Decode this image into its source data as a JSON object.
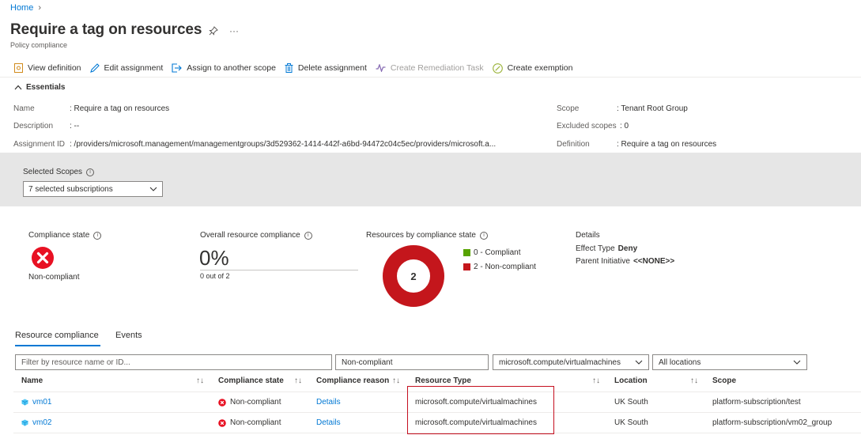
{
  "breadcrumb": {
    "home": "Home"
  },
  "page": {
    "title": "Require a tag on resources",
    "subtitle": "Policy compliance",
    "more": "···"
  },
  "toolbar": {
    "view_definition": "View definition",
    "edit_assignment": "Edit assignment",
    "assign_scope": "Assign to another scope",
    "delete_assignment": "Delete assignment",
    "create_remediation": "Create Remediation Task",
    "create_exemption": "Create exemption"
  },
  "essentials": {
    "header": "Essentials",
    "name_label": "Name",
    "name_value": ": Require a tag on resources",
    "description_label": "Description",
    "description_value": ": --",
    "assignment_id_label": "Assignment ID",
    "assignment_id_value": ": /providers/microsoft.management/managementgroups/3d529362-1414-442f-a6bd-94472c04c5ec/providers/microsoft.a...",
    "scope_label": "Scope",
    "scope_value": ": Tenant Root Group",
    "excluded_label": "Excluded scopes",
    "excluded_value": ": 0",
    "definition_label": "Definition",
    "definition_value": ": Require a tag on resources"
  },
  "scopes": {
    "label": "Selected Scopes",
    "selected": "7 selected subscriptions"
  },
  "summary": {
    "compliance_state_label": "Compliance state",
    "compliance_state_value": "Non-compliant",
    "overall_label": "Overall resource compliance",
    "overall_pct": "0%",
    "overall_sub": "0 out of 2",
    "by_state_label": "Resources by compliance state",
    "donut_center": "2",
    "legend": [
      {
        "label": "0 - Compliant",
        "color": "#57a300"
      },
      {
        "label": "2 - Non-compliant",
        "color": "#c4161c"
      }
    ],
    "donut_values": {
      "compliant": 0,
      "noncompliant": 2
    },
    "details_label": "Details",
    "effect_label": "Effect Type",
    "effect_value": "Deny",
    "parent_label": "Parent Initiative",
    "parent_value": "<<NONE>>"
  },
  "tabs": {
    "resource_compliance": "Resource compliance",
    "events": "Events"
  },
  "filters": {
    "search_placeholder": "Filter by resource name or ID...",
    "state": "Non-compliant",
    "resource_type": "microsoft.compute/virtualmachines",
    "location": "All locations"
  },
  "table": {
    "columns": {
      "name": "Name",
      "state": "Compliance state",
      "reason": "Compliance reason",
      "type": "Resource Type",
      "location": "Location",
      "scope": "Scope"
    },
    "rows": [
      {
        "name": "vm01",
        "state": "Non-compliant",
        "reason": "Details",
        "type": "microsoft.compute/virtualmachines",
        "location": "UK South",
        "scope": "platform-subscription/test"
      },
      {
        "name": "vm02",
        "state": "Non-compliant",
        "reason": "Details",
        "type": "microsoft.compute/virtualmachines",
        "location": "UK South",
        "scope": "platform-subscription/vm02_group"
      }
    ]
  }
}
